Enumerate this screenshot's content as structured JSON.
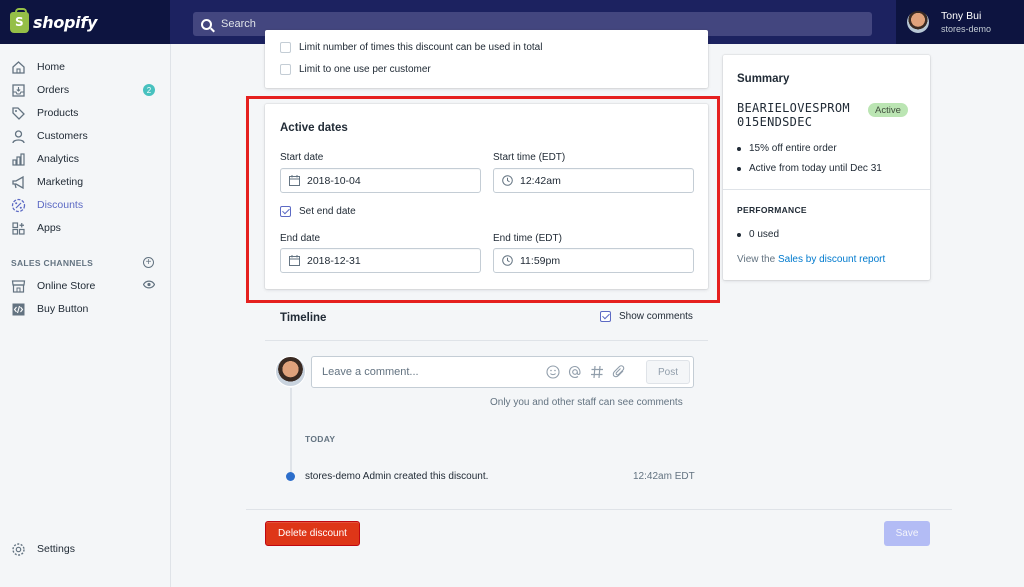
{
  "brand": {
    "name": "shopify"
  },
  "search": {
    "placeholder": "Search"
  },
  "user": {
    "name": "Tony Bui",
    "store": "stores-demo"
  },
  "sidebar": {
    "items": [
      {
        "label": "Home",
        "icon": "home-icon"
      },
      {
        "label": "Orders",
        "icon": "orders-icon",
        "badge": "2"
      },
      {
        "label": "Products",
        "icon": "tag-icon"
      },
      {
        "label": "Customers",
        "icon": "customer-icon"
      },
      {
        "label": "Analytics",
        "icon": "analytics-icon"
      },
      {
        "label": "Marketing",
        "icon": "megaphone-icon"
      },
      {
        "label": "Discounts",
        "icon": "discount-icon",
        "active": true
      },
      {
        "label": "Apps",
        "icon": "apps-icon"
      }
    ],
    "sales_channels_title": "SALES CHANNELS",
    "channels": [
      {
        "label": "Online Store",
        "icon": "store-icon"
      },
      {
        "label": "Buy Button",
        "icon": "code-icon"
      }
    ],
    "settings_label": "Settings"
  },
  "usage": {
    "limit_total": "Limit number of times this discount can be used in total",
    "limit_customer": "Limit to one use per customer"
  },
  "active_dates": {
    "title": "Active dates",
    "start_date_label": "Start date",
    "start_date": "2018-10-04",
    "start_time_label": "Start time (EDT)",
    "start_time": "12:42am",
    "set_end_label": "Set end date",
    "end_date_label": "End date",
    "end_date": "2018-12-31",
    "end_time_label": "End time (EDT)",
    "end_time": "11:59pm"
  },
  "timeline": {
    "title": "Timeline",
    "show_comments": "Show comments",
    "comment_placeholder": "Leave a comment...",
    "post_label": "Post",
    "staff_note": "Only you and other staff can see comments",
    "day": "TODAY",
    "event_text": "stores-demo Admin created this discount.",
    "event_time": "12:42am EDT"
  },
  "summary": {
    "title": "Summary",
    "code_line1": "BEARIELOVESPROM",
    "code_line2": "015ENDSDEC",
    "status": "Active",
    "details": [
      "15% off entire order",
      "Active from today until Dec 31"
    ],
    "performance_title": "PERFORMANCE",
    "used": "0 used",
    "view_prefix": "View the",
    "report_link": "Sales by discount report"
  },
  "footer": {
    "delete_label": "Delete discount",
    "save_label": "Save"
  },
  "colors": {
    "accent": "#5c6ac4",
    "danger": "#de3618",
    "topbar": "#1c2260",
    "highlight": "#e5201f"
  }
}
